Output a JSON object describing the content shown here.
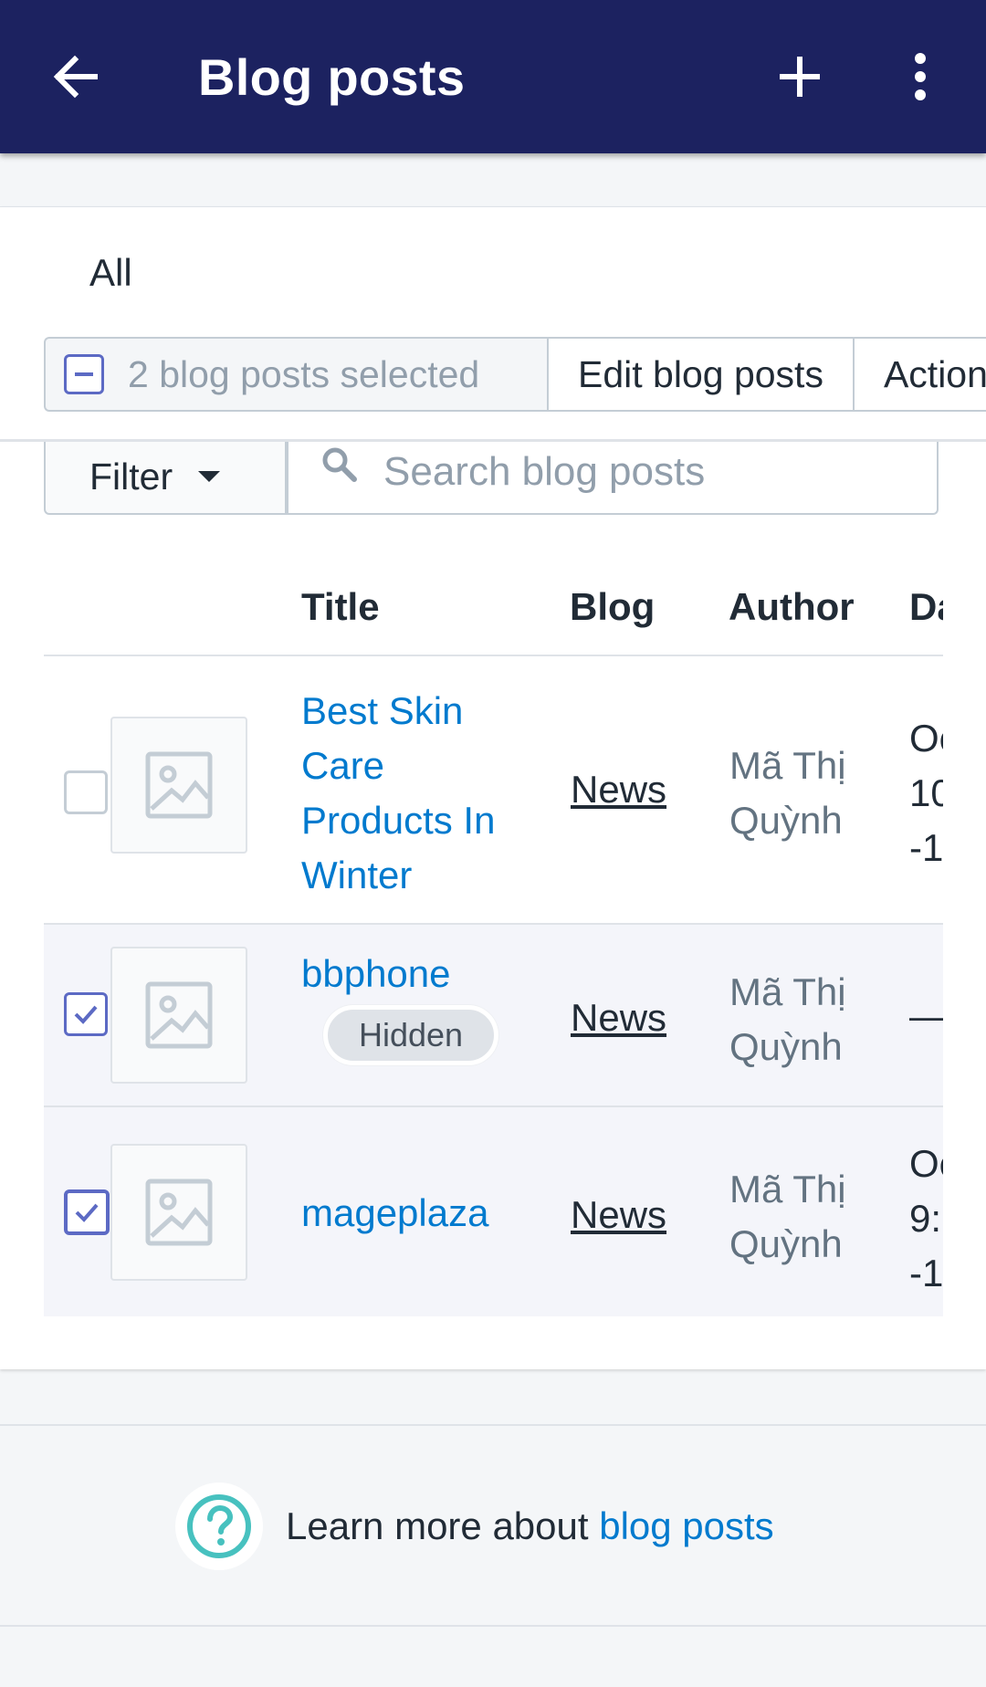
{
  "header": {
    "title": "Blog posts",
    "background": "#1c2260"
  },
  "tabs": [
    {
      "label": "All"
    }
  ],
  "bulk_actions": {
    "selected_label": "2 blog posts selected",
    "edit_label": "Edit blog posts",
    "actions_label": "Actions"
  },
  "filter": {
    "button_label": "Filter",
    "search_placeholder": "Search blog posts"
  },
  "table": {
    "columns": [
      "Title",
      "Blog",
      "Author",
      "Date"
    ],
    "rows": [
      {
        "title_lines": [
          "Best Skin",
          "Care",
          "Products In",
          "Winter"
        ],
        "badge": "",
        "blog": "News",
        "author_lines": [
          "Mã Thị",
          "Quỳnh"
        ],
        "date_lines": [
          "Oct",
          "10",
          "-1"
        ],
        "selected": false
      },
      {
        "title_lines": [
          "bbphone"
        ],
        "badge": "Hidden",
        "blog": "News",
        "author_lines": [
          "Mã Thị",
          "Quỳnh"
        ],
        "date_lines": [
          "—"
        ],
        "selected": true
      },
      {
        "title_lines": [
          "mageplaza"
        ],
        "badge": "",
        "blog": "News",
        "author_lines": [
          "Mã Thị",
          "Quỳnh"
        ],
        "date_lines": [
          "Oct",
          "9:",
          "-1"
        ],
        "selected": true
      }
    ]
  },
  "footer": {
    "help_prefix": "Learn more about ",
    "help_link": "blog posts",
    "help_icon_color": "#47c1bf",
    "link_color": "#007ace"
  }
}
